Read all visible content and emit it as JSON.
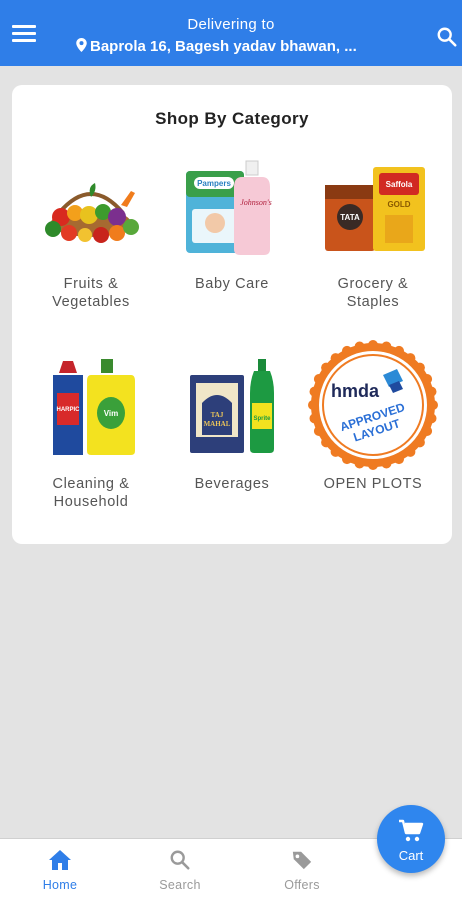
{
  "header": {
    "delivering_label": "Delivering to",
    "address": "Baprola 16, Bagesh yadav bhawan, ..."
  },
  "main": {
    "section_title": "Shop By Category",
    "categories": [
      {
        "label": "Fruits &\nVegetables",
        "icon": "fruits-vegetables-basket-icon"
      },
      {
        "label": "Baby Care",
        "icon": "baby-care-products-icon"
      },
      {
        "label": "Grocery &\nStaples",
        "icon": "grocery-staples-icon"
      },
      {
        "label": "Cleaning &\nHousehold",
        "icon": "cleaning-bottles-icon"
      },
      {
        "label": "Beverages",
        "icon": "beverages-icon"
      },
      {
        "label": "OPEN PLOTS",
        "icon": "approved-layout-seal-icon"
      }
    ],
    "plots_badge": {
      "brand": "hmda",
      "line1": "APPROVED",
      "line2": "LAYOUT"
    }
  },
  "bottom_nav": {
    "items": [
      {
        "label": "Home",
        "icon": "home-icon",
        "active": true
      },
      {
        "label": "Search",
        "icon": "search-icon",
        "active": false
      },
      {
        "label": "Offers",
        "icon": "tag-icon",
        "active": false
      }
    ]
  },
  "cart": {
    "label": "Cart",
    "icon": "cart-icon"
  },
  "colors": {
    "primary": "#2f7ee8",
    "background": "#e3e3e3",
    "inactive": "#9a9a9a",
    "badge_orange": "#ef7b22"
  }
}
